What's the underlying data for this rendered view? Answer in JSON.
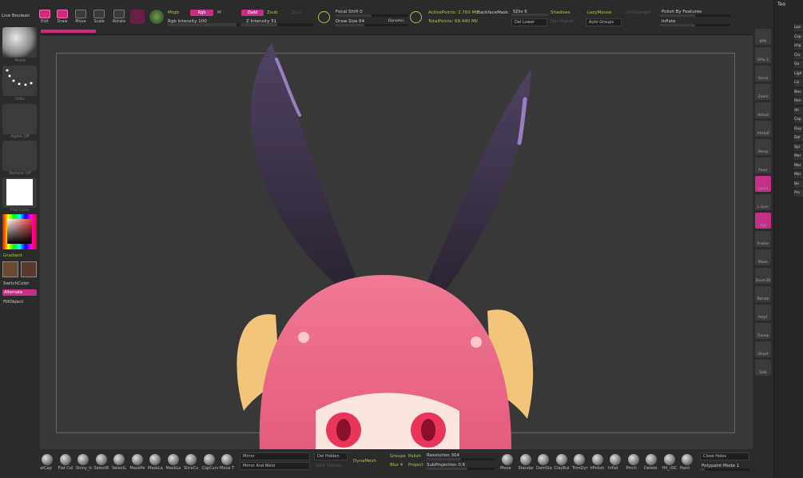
{
  "toolbar": {
    "live_boolean": "Live Boolean",
    "tools": [
      {
        "label": "Edit",
        "active": true
      },
      {
        "label": "Draw",
        "active": true
      },
      {
        "label": "Move",
        "active": false
      },
      {
        "label": "Scale",
        "active": false
      },
      {
        "label": "Rotate",
        "active": false
      }
    ],
    "mrgb": "Mrgb",
    "rgb": "Rgb",
    "m": "M",
    "zadd": "Zadd",
    "zsub": "Zsub",
    "zcut": "Zcut",
    "rgb_intensity": "Rgb Intensity 100",
    "z_intensity": "Z Intensity 51",
    "focal_shift": "Focal Shift 0",
    "draw_size": "Draw Size 64",
    "dynamic": "Dynamic",
    "active_points": "ActivePoints: 2.760 Mil",
    "total_points": "TotalPoints: 69.440 Mil",
    "backface_mask": "BackfaceMask",
    "sdiv": "SDiv 6",
    "del_lower": "Del Lower",
    "del_higher": "Del Higher",
    "shadows": "Shadows",
    "lazymouse": "LazyMouse",
    "auto_groups": "Auto Groups",
    "polish_by_features": "Polish By Features",
    "inflate": "Inflate",
    "strength_label": "StrStrength"
  },
  "left_panel": {
    "brush_caption": "Move",
    "stroke_caption": "Dots",
    "alpha_caption": "Alpha Off",
    "texture_caption": "Texture Off",
    "material_caption": "Flat Color",
    "gradient": "Gradient",
    "switch_color": "SwitchColor",
    "alternate": "Alternate",
    "fill_object": "FillObject"
  },
  "right_shelf": [
    {
      "label": "BPR"
    },
    {
      "label": "SPix 3"
    },
    {
      "label": "Scroll"
    },
    {
      "label": "Zoom"
    },
    {
      "label": "Actual"
    },
    {
      "label": "AAHalf"
    },
    {
      "label": "Persp"
    },
    {
      "label": "Floor"
    },
    {
      "label": "Local"
    },
    {
      "label": "L.Sym"
    },
    {
      "label": "Xyz"
    },
    {
      "label": "Frame"
    },
    {
      "label": "Move"
    },
    {
      "label": "Zoom3D"
    },
    {
      "label": "Rotate"
    },
    {
      "label": "PolyF"
    },
    {
      "label": "Transp"
    },
    {
      "label": "Ghost"
    },
    {
      "label": "Solo"
    }
  ],
  "far_right": {
    "header": "Too",
    "items": [
      "Loa",
      "Cop",
      "Imp",
      "Clo",
      "Go",
      "Ligh",
      "Lis",
      "Nev",
      "Ren",
      "All",
      "Cop",
      "Dup",
      "Del",
      "Spl",
      "Mer",
      "Mer",
      "Mer",
      "Bo",
      "Pro"
    ]
  },
  "bottom": {
    "brushes": [
      "atCap",
      "Flat Col",
      "Shiny_tr",
      "SelectR",
      "SelectL",
      "MaskPe",
      "MaskLa",
      "MaskLa",
      "SliceCu",
      "ClipCurv",
      "Move T"
    ],
    "mirror": "Mirror",
    "mirror_and_weld": "Mirror And Weld",
    "del_hidden": "Del Hidden",
    "split_hidden": "Split Hidden",
    "dynamesh": "DynaMesh",
    "groups": "Groups",
    "polish": "Polish",
    "blur": "Blur 4",
    "project": "Project",
    "resolution": "Resolution 304",
    "subprojection": "SubProjection 0.6",
    "sculpt_brushes": [
      "Move",
      "Standar",
      "DamSta",
      "ClayBui",
      "TrimDyr",
      "hPolish",
      "Inflat",
      "Pinch",
      "Delete",
      "Hit_ilSC",
      "Paint"
    ],
    "close_holes": "Close Holes",
    "polypaint_mode": "Polypaint Mode 1"
  },
  "colors": {
    "accent_pink": "#d4287e",
    "accent_green": "#a9c64a",
    "hair_pink": "#ef6f90",
    "ear_purple": "#4a3f58",
    "horn_yellow": "#f2c57a",
    "eye_red": "#e8365a"
  }
}
